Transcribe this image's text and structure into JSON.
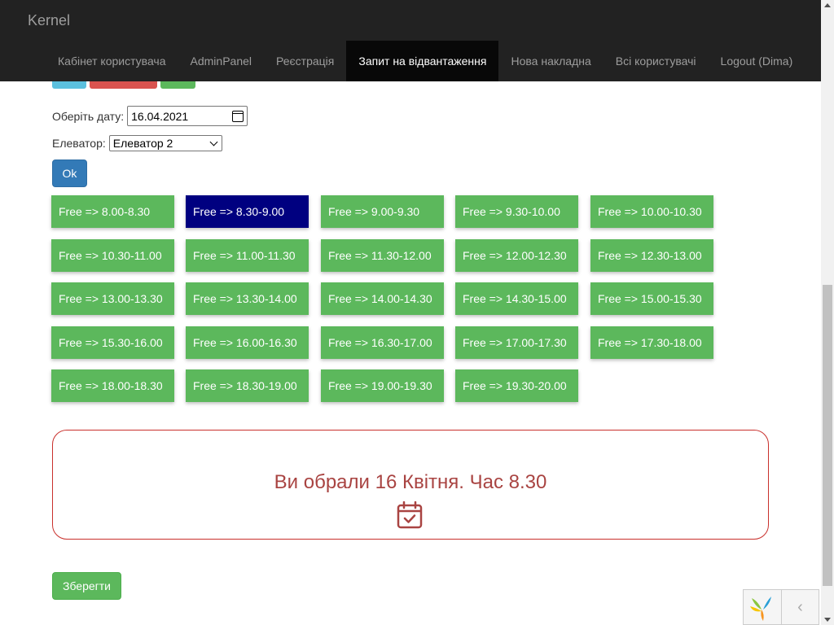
{
  "navbar": {
    "brand": "Kernel",
    "items": [
      {
        "label": "Кабінет користувача",
        "active": false
      },
      {
        "label": "AdminPanel",
        "active": false
      },
      {
        "label": "Реєстрація",
        "active": false
      },
      {
        "label": "Запит на відвантаження",
        "active": true
      },
      {
        "label": "Нова накладна",
        "active": false
      },
      {
        "label": "Всі користувачі",
        "active": false
      },
      {
        "label": "Logout (Dima)",
        "active": false
      }
    ]
  },
  "form": {
    "date_label": "Оберіть дату:",
    "date_value": "16.04.2021",
    "elevator_label": "Елеватор:",
    "elevator_value": "Елеватор 2",
    "ok_label": "Ok"
  },
  "slots": [
    {
      "label": "Free => 8.00-8.30",
      "selected": false
    },
    {
      "label": "Free => 8.30-9.00",
      "selected": true
    },
    {
      "label": "Free => 9.00-9.30",
      "selected": false
    },
    {
      "label": "Free => 9.30-10.00",
      "selected": false
    },
    {
      "label": "Free => 10.00-10.30",
      "selected": false
    },
    {
      "label": "Free => 10.30-11.00",
      "selected": false
    },
    {
      "label": "Free => 11.00-11.30",
      "selected": false
    },
    {
      "label": "Free => 11.30-12.00",
      "selected": false
    },
    {
      "label": "Free => 12.00-12.30",
      "selected": false
    },
    {
      "label": "Free => 12.30-13.00",
      "selected": false
    },
    {
      "label": "Free => 13.00-13.30",
      "selected": false
    },
    {
      "label": "Free => 13.30-14.00",
      "selected": false
    },
    {
      "label": "Free => 14.00-14.30",
      "selected": false
    },
    {
      "label": "Free => 14.30-15.00",
      "selected": false
    },
    {
      "label": "Free => 15.00-15.30",
      "selected": false
    },
    {
      "label": "Free => 15.30-16.00",
      "selected": false
    },
    {
      "label": "Free => 16.00-16.30",
      "selected": false
    },
    {
      "label": "Free => 16.30-17.00",
      "selected": false
    },
    {
      "label": "Free => 17.00-17.30",
      "selected": false
    },
    {
      "label": "Free => 17.30-18.00",
      "selected": false
    },
    {
      "label": "Free => 18.00-18.30",
      "selected": false
    },
    {
      "label": "Free => 18.30-19.00",
      "selected": false
    },
    {
      "label": "Free => 19.00-19.30",
      "selected": false
    },
    {
      "label": "Free => 19.30-20.00",
      "selected": false
    }
  ],
  "result": {
    "text": "Ви обрали 16 Квітня. Час 8.30",
    "icon": "calendar-check-icon"
  },
  "save_label": "Зберегти",
  "colors": {
    "navbar_bg": "#222222",
    "slot_free": "#5cb85c",
    "slot_selected": "#000080",
    "primary": "#337ab7",
    "result_text": "#a94442",
    "result_border": "#c9302c"
  }
}
